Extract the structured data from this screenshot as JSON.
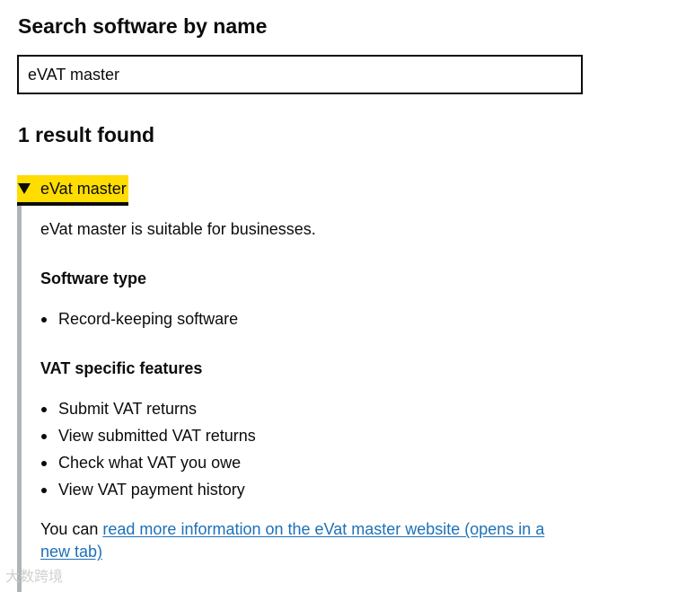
{
  "search": {
    "heading": "Search software by name",
    "value": "eVAT master"
  },
  "results": {
    "count_text": "1 result found"
  },
  "result": {
    "summary": "eVat master",
    "description": "eVat master is suitable for businesses.",
    "software_type_heading": "Software type",
    "software_types": [
      "Record-keeping software"
    ],
    "vat_features_heading": "VAT specific features",
    "vat_features": [
      "Submit VAT returns",
      "View submitted VAT returns",
      "Check what VAT you owe",
      "View VAT payment history"
    ],
    "more_info_prefix": "You can ",
    "more_info_link": "read more information on the eVat master website (opens in a new tab)"
  },
  "watermark": "大数跨境",
  "colors": {
    "focus_yellow": "#ffdd00",
    "link_blue": "#1d70b8",
    "text": "#0b0c0c",
    "inset_border": "#b1b4b6"
  }
}
